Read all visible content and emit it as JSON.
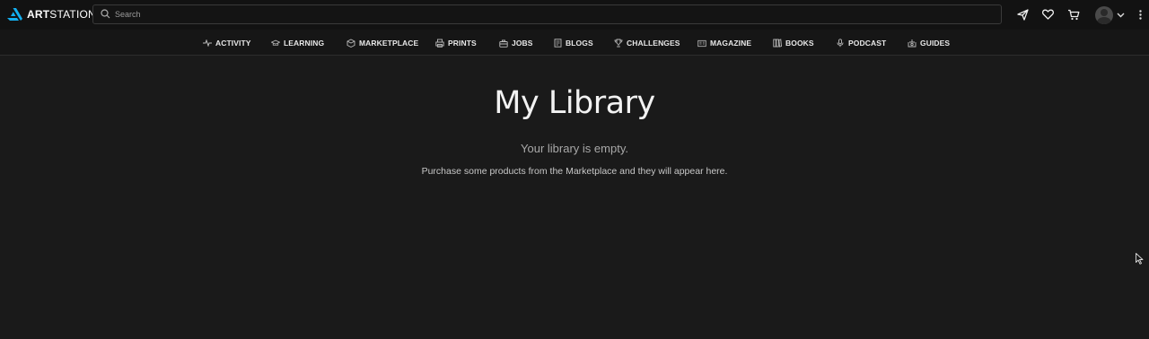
{
  "brand": {
    "logo_bold": "ART",
    "logo_rest": "STATION",
    "accent": "#13aff0"
  },
  "search": {
    "placeholder": "Search"
  },
  "top_icons": [
    "send-icon",
    "heart-icon",
    "cart-icon",
    "more-icon"
  ],
  "nav": [
    {
      "label": "ACTIVITY",
      "icon": "activity-icon"
    },
    {
      "label": "LEARNING",
      "icon": "graduation-cap-icon"
    },
    {
      "label": "MARKETPLACE",
      "icon": "cube-icon"
    },
    {
      "label": "PRINTS",
      "icon": "print-icon"
    },
    {
      "label": "JOBS",
      "icon": "briefcase-icon"
    },
    {
      "label": "BLOGS",
      "icon": "blog-icon"
    },
    {
      "label": "CHALLENGES",
      "icon": "trophy-icon"
    },
    {
      "label": "MAGAZINE",
      "icon": "magazine-icon"
    },
    {
      "label": "BOOKS",
      "icon": "books-icon"
    },
    {
      "label": "PODCAST",
      "icon": "microphone-icon"
    },
    {
      "label": "GUIDES",
      "icon": "guides-icon"
    }
  ],
  "main": {
    "title": "My Library",
    "empty_title": "Your library is empty.",
    "empty_desc": "Purchase some products from the Marketplace and they will appear here."
  }
}
